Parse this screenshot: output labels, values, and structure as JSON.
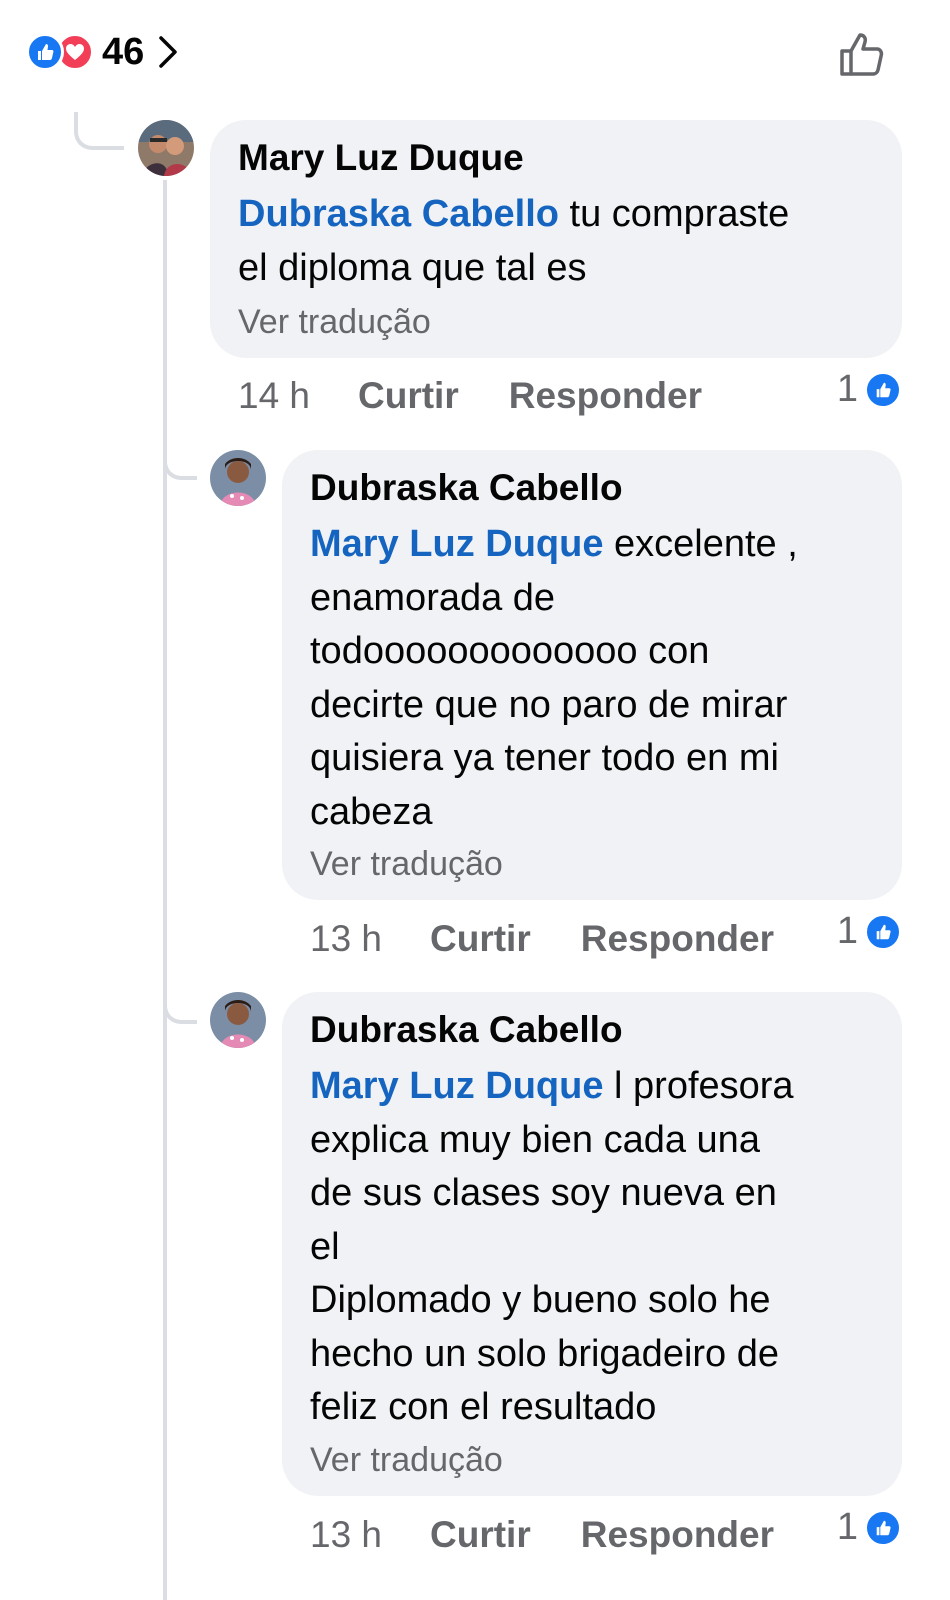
{
  "reactions": {
    "icons": [
      "like-icon",
      "love-icon"
    ],
    "count": "46"
  },
  "colors": {
    "like_blue": "#1877f2",
    "love_red": "#f33e58",
    "mention_blue": "#1565c0",
    "bubble_bg": "#f0f2f5",
    "meta_gray": "#65676b"
  },
  "comments": [
    {
      "author": "Mary Luz Duque",
      "mention": "Dubraska Cabello",
      "text": " tu compraste\nel diploma que tal es",
      "translate": "Ver tradução",
      "time": "14 h",
      "like_label": "Curtir",
      "reply_label": "Responder",
      "likes": "1"
    },
    {
      "author": "Dubraska Cabello",
      "mention": "Mary Luz Duque",
      "text": " excelente ,\nenamorada de\ntodooooooooooooo con\ndecirte que no paro de mirar\nquisiera ya tener todo en mi\ncabeza",
      "translate": "Ver tradução",
      "time": "13 h",
      "like_label": "Curtir",
      "reply_label": "Responder",
      "likes": "1"
    },
    {
      "author": "Dubraska Cabello",
      "mention": "Mary Luz Duque",
      "text": " l profesora\nexplica muy bien cada una\nde sus clases soy nueva en\nel\nDiplomado y bueno solo he\nhecho un solo brigadeiro de\nfeliz con el resultado",
      "translate": "Ver tradução",
      "time": "13 h",
      "like_label": "Curtir",
      "reply_label": "Responder",
      "likes": "1"
    }
  ]
}
